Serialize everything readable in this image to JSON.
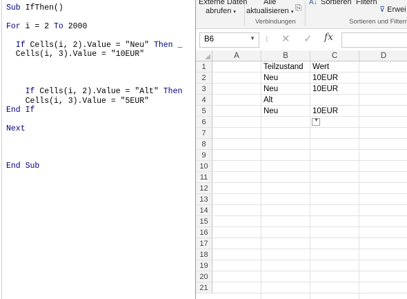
{
  "code": {
    "lines": [
      [
        "Sub IfThen()"
      ],
      [
        "For i = 2 To 2000"
      ],
      [
        "  If Cells(i, 2).Value = \"Neu\" Then _"
      ],
      [
        "  Cells(i, 3).Value = \"10EUR\""
      ],
      [
        "    If Cells(i, 2).Value = \"Alt\" Then"
      ],
      [
        "    Cells(i, 3).Value = \"5EUR\""
      ],
      [
        "End If"
      ],
      [
        "Next"
      ],
      [
        "End Sub"
      ]
    ]
  },
  "ribbon": {
    "external_data_line1": "Externe Daten",
    "external_data_line2": "abrufen",
    "refresh_line1": "Alle",
    "refresh_line2": "aktualisieren",
    "sort": "Sortieren",
    "filter": "Filtern",
    "advanced": "Erwei",
    "group_connections": "Verbindungen",
    "group_sort_filter": "Sortieren und Filtern"
  },
  "formula_bar": {
    "name_box": "B6",
    "fx": "fx",
    "value": ""
  },
  "grid": {
    "columns": [
      "A",
      "B",
      "C",
      "D"
    ],
    "rows": [
      "1",
      "2",
      "3",
      "4",
      "5",
      "6",
      "7",
      "8",
      "9",
      "10",
      "11",
      "12",
      "13",
      "14",
      "15",
      "16",
      "17",
      "18",
      "19",
      "20",
      "21"
    ],
    "cells": {
      "B1": "Teilzustand",
      "C1": "Wert",
      "B2": "Neu",
      "C2": "10EUR",
      "B3": "Neu",
      "C3": "10EUR",
      "B4": "Alt",
      "B5": "Neu",
      "C5": "10EUR"
    }
  }
}
